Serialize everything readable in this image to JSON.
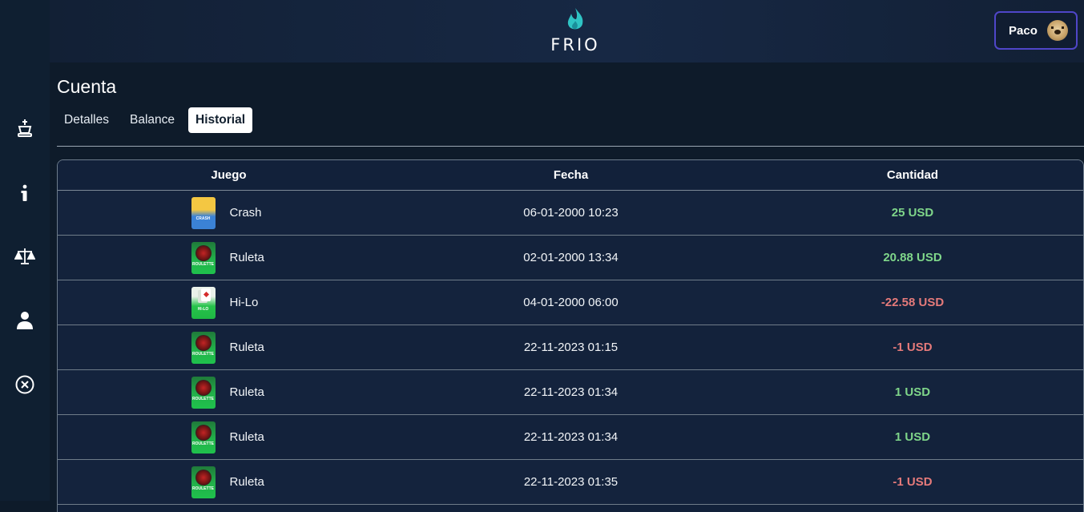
{
  "app": {
    "logo_text": "FRIO"
  },
  "user": {
    "name": "Paco"
  },
  "sidebar": {
    "items": [
      {
        "icon": "chess-king-icon"
      },
      {
        "icon": "info-icon"
      },
      {
        "icon": "scale-icon"
      },
      {
        "icon": "user-icon"
      },
      {
        "icon": "close-circle-icon"
      }
    ]
  },
  "page": {
    "title": "Cuenta"
  },
  "tabs": [
    {
      "label": "Detalles",
      "active": false
    },
    {
      "label": "Balance",
      "active": false
    },
    {
      "label": "Historial",
      "active": true
    }
  ],
  "table": {
    "headers": [
      "Juego",
      "Fecha",
      "Cantidad"
    ],
    "rows": [
      {
        "game": "Crash",
        "thumb": "crash",
        "thumb_label": "CRASH",
        "date": "06-01-2000 10:23",
        "amount": "25 USD",
        "sign": "pos"
      },
      {
        "game": "Ruleta",
        "thumb": "roulette",
        "thumb_label": "ROULETTE",
        "date": "02-01-2000 13:34",
        "amount": "20.88 USD",
        "sign": "pos"
      },
      {
        "game": "Hi-Lo",
        "thumb": "hilo",
        "thumb_label": "HI-LO",
        "date": "04-01-2000 06:00",
        "amount": "-22.58 USD",
        "sign": "neg"
      },
      {
        "game": "Ruleta",
        "thumb": "roulette",
        "thumb_label": "ROULETTE",
        "date": "22-11-2023 01:15",
        "amount": "-1 USD",
        "sign": "neg"
      },
      {
        "game": "Ruleta",
        "thumb": "roulette",
        "thumb_label": "ROULETTE",
        "date": "22-11-2023 01:34",
        "amount": "1 USD",
        "sign": "pos"
      },
      {
        "game": "Ruleta",
        "thumb": "roulette",
        "thumb_label": "ROULETTE",
        "date": "22-11-2023 01:34",
        "amount": "1 USD",
        "sign": "pos"
      },
      {
        "game": "Ruleta",
        "thumb": "roulette",
        "thumb_label": "ROULETTE",
        "date": "22-11-2023 01:35",
        "amount": "-1 USD",
        "sign": "neg"
      }
    ]
  },
  "colors": {
    "positive": "#7fd68a",
    "negative": "#e57a7a",
    "accent": "#4f46c8",
    "flame": "#2fc4c4"
  }
}
